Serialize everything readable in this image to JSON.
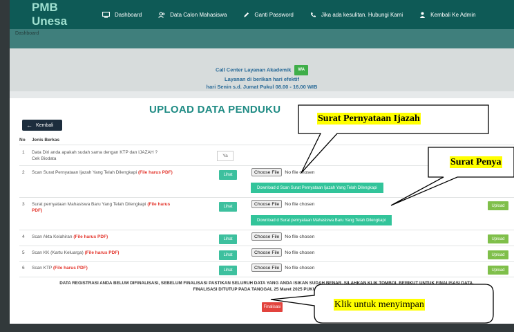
{
  "topbar": {
    "brand": "PMB Unesa",
    "nav": [
      {
        "label": "Dashboard",
        "icon": "monitor-icon"
      },
      {
        "label": "Data Calon Mahasiswa",
        "icon": "users-icon"
      },
      {
        "label": "Ganti Password",
        "icon": "pencil-icon"
      },
      {
        "label": "Jika ada kesulitan. Hubungi Kami",
        "icon": "phone-icon"
      },
      {
        "label": "Kembali Ke Admin",
        "icon": "user-icon"
      }
    ]
  },
  "breadcrumb": "Dashboard",
  "callcenter": {
    "line1": "Call Center Layanan Akademik",
    "wa": "WA",
    "line2": "Layanan di berikan hari efektif",
    "line3": "hari Senin s.d. Jumat Pukul 08.00 - 16.00 WIB"
  },
  "page_title": "UPLOAD DATA PENDUKU",
  "back_label": "Kembali",
  "table": {
    "headers": {
      "no": "No",
      "jenis": "Jenis Berkas"
    },
    "rows": [
      {
        "no": "1",
        "label": "Data Diri anda apakah sudah sama dengan KTP dan IJAZAH ?",
        "label2": "Cek Biodata",
        "red": "",
        "value": "Ya"
      },
      {
        "no": "2",
        "label": "Scan Surat Pernyataan Ijazah Yang Telah Dilengkapi ",
        "red": "(File harus PDF)",
        "lihat": "Lihat",
        "choose": "Choose File",
        "nofile": "No file chosen",
        "download": "Download d Scan Surat Pernyataan Ijazah Yang Telah Dilengkapi"
      },
      {
        "no": "3",
        "label": "Surat pernyataan Mahasiswa Baru Yang Telah Dilengkapi ",
        "red": "(File harus",
        "red2": "PDF)",
        "lihat": "Lihat",
        "choose": "Choose File",
        "nofile": "No file chosen",
        "download": "Download d Surat pernyataan Mahasiswa Baru Yang Telah Dilengkapi",
        "upload": "Upload"
      },
      {
        "no": "4",
        "label": "Scan Akta Kelahiran ",
        "red": "(File harus PDF)",
        "lihat": "Lihat",
        "choose": "Choose File",
        "nofile": "No file chosen",
        "upload": "Upload"
      },
      {
        "no": "5",
        "label": "Scan KK (Kartu Keluarga) ",
        "red": "(File harus PDF)",
        "lihat": "Lihat",
        "choose": "Choose File",
        "nofile": "No file chosen",
        "upload": "Upload"
      },
      {
        "no": "6",
        "label": "Scan KTP ",
        "red": "(File harus PDF)",
        "lihat": "Lihat",
        "choose": "Choose File",
        "nofile": "No file chosen",
        "upload": "Upload"
      }
    ]
  },
  "notice": {
    "line1": "DATA REGISTRASI ANDA BELUM DIFINALISASI, SEBELUM FINALISASI PASTIKAN SELURUH DATA YANG ANDA ISIKAN SUDAH BENAR. SILAHKAN KLIK TOMBOL BERIKUT UNTUK FINALISASI DATA.",
    "line2": "FINALISASI DITUTUP PADA TANGGAL 25 Maret 2025 PUKUL 23.59 WIB"
  },
  "finalisasi_label": "Finalisasi",
  "annotations": {
    "bubble1": "Surat Pernyataan Ijazah",
    "bubble2": "Surat Penya",
    "bubble3": "Klik untuk menyimpan"
  },
  "colors": {
    "topbar": "#0e5a56",
    "accent_green": "#3dc09e",
    "upload_green": "#7fbf4a",
    "danger_red": "#e2433d",
    "highlight_yellow": "#ffff00"
  }
}
